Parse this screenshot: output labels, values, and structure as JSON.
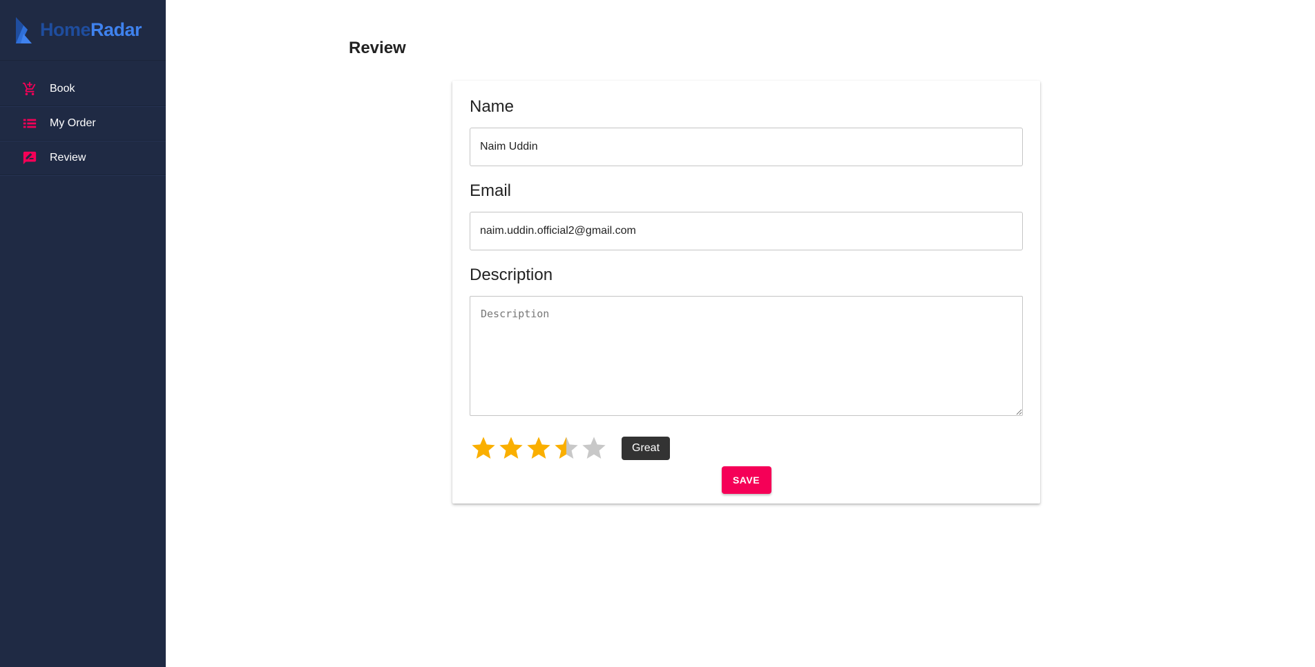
{
  "app": {
    "logo_part1": "Home",
    "logo_part2": "Radar"
  },
  "sidebar": {
    "items": [
      {
        "label": "Book",
        "icon": "cart-plus-icon"
      },
      {
        "label": "My Order",
        "icon": "list-icon"
      },
      {
        "label": "Review",
        "icon": "rate-review-icon"
      }
    ]
  },
  "page": {
    "title": "Review"
  },
  "form": {
    "name_label": "Name",
    "name_value": "Naim Uddin",
    "email_label": "Email",
    "email_value": "naim.uddin.official2@gmail.com",
    "description_label": "Description",
    "description_placeholder": "Description",
    "rating_value": 3.5,
    "rating_max": 5,
    "rating_label": "Great",
    "save_label": "SAVE"
  },
  "colors": {
    "sidebar_bg": "#1f2a44",
    "accent": "#f50057",
    "star_filled": "#faaf00",
    "star_empty": "#c8c8c8",
    "logo_dark": "#1f4d9e",
    "logo_light": "#3f82ee"
  }
}
